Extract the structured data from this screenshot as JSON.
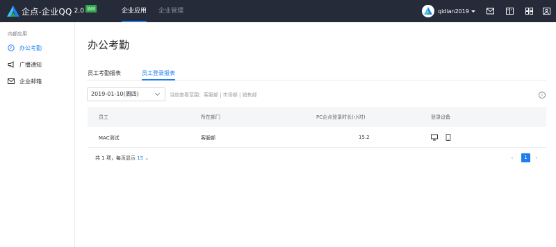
{
  "app": {
    "logo_text": "企点-企业QQ",
    "logo_version": "2.0",
    "logo_badge": "协同"
  },
  "topnav": {
    "items": [
      {
        "label": "企业应用",
        "active": true
      },
      {
        "label": "企业管理",
        "active": false
      }
    ]
  },
  "user": {
    "name": "qidian2019"
  },
  "sidebar": {
    "title": "内部应用",
    "items": [
      {
        "label": "办公考勤",
        "icon": "clock-icon",
        "active": true
      },
      {
        "label": "广播通知",
        "icon": "megaphone-icon",
        "active": false
      },
      {
        "label": "企业邮箱",
        "icon": "mail-icon",
        "active": false
      }
    ]
  },
  "main": {
    "title": "办公考勤",
    "tabs": [
      {
        "label": "员工考勤报表",
        "active": false
      },
      {
        "label": "员工登录报表",
        "active": true
      }
    ],
    "date_value": "2019-01-10(周四)",
    "scope_text": "当前查看范围：客服部 | 市场部 | 销售部",
    "table": {
      "headers": [
        "员工",
        "所在部门",
        "PC企点登录时长(小时)",
        "登录设备"
      ],
      "rows": [
        {
          "employee": "MAC测试",
          "department": "客服部",
          "duration": "15.2",
          "devices": [
            "desktop-icon",
            "tablet-icon"
          ]
        }
      ]
    },
    "footer": {
      "total_text": "共 1 项，每页显示",
      "page_size": "15"
    },
    "pagination": {
      "current_page": "1"
    }
  },
  "colors": {
    "accent": "#1e7ef0",
    "topbar": "#262b3a",
    "badge": "#2ea84a"
  }
}
